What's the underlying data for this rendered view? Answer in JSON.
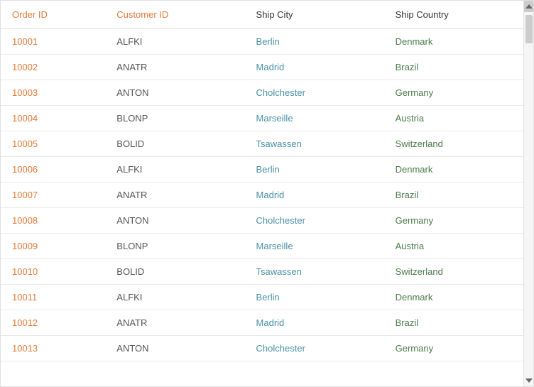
{
  "columns": [
    {
      "key": "order_id",
      "label": "Order ID"
    },
    {
      "key": "customer_id",
      "label": "Customer ID"
    },
    {
      "key": "ship_city",
      "label": "Ship City"
    },
    {
      "key": "ship_country",
      "label": "Ship Country"
    }
  ],
  "rows": [
    {
      "order_id": "10001",
      "customer_id": "ALFKI",
      "ship_city": "Berlin",
      "ship_country": "Denmark"
    },
    {
      "order_id": "10002",
      "customer_id": "ANATR",
      "ship_city": "Madrid",
      "ship_country": "Brazil"
    },
    {
      "order_id": "10003",
      "customer_id": "ANTON",
      "ship_city": "Cholchester",
      "ship_country": "Germany"
    },
    {
      "order_id": "10004",
      "customer_id": "BLONP",
      "ship_city": "Marseille",
      "ship_country": "Austria"
    },
    {
      "order_id": "10005",
      "customer_id": "BOLID",
      "ship_city": "Tsawassen",
      "ship_country": "Switzerland"
    },
    {
      "order_id": "10006",
      "customer_id": "ALFKI",
      "ship_city": "Berlin",
      "ship_country": "Denmark"
    },
    {
      "order_id": "10007",
      "customer_id": "ANATR",
      "ship_city": "Madrid",
      "ship_country": "Brazil"
    },
    {
      "order_id": "10008",
      "customer_id": "ANTON",
      "ship_city": "Cholchester",
      "ship_country": "Germany"
    },
    {
      "order_id": "10009",
      "customer_id": "BLONP",
      "ship_city": "Marseille",
      "ship_country": "Austria"
    },
    {
      "order_id": "10010",
      "customer_id": "BOLID",
      "ship_city": "Tsawassen",
      "ship_country": "Switzerland"
    },
    {
      "order_id": "10011",
      "customer_id": "ALFKI",
      "ship_city": "Berlin",
      "ship_country": "Denmark"
    },
    {
      "order_id": "10012",
      "customer_id": "ANATR",
      "ship_city": "Madrid",
      "ship_country": "Brazil"
    },
    {
      "order_id": "10013",
      "customer_id": "ANTON",
      "ship_city": "Cholchester",
      "ship_country": "Germany"
    }
  ]
}
